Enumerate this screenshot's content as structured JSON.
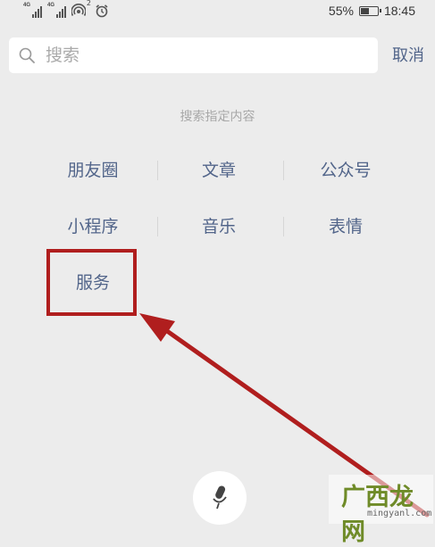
{
  "status_bar": {
    "signal_1_label": "4G",
    "signal_2_label": "4G",
    "hotspot_superscript": "2",
    "battery_percent": "55%",
    "battery_level": 0.55,
    "time": "18:45",
    "icons": [
      "signal-icon",
      "signal-icon",
      "hotspot-icon",
      "alarm-icon",
      "battery-icon"
    ]
  },
  "search": {
    "placeholder": "搜索",
    "cancel_label": "取消",
    "icon": "search-icon"
  },
  "hint": "搜索指定内容",
  "categories": [
    {
      "label": "朋友圈"
    },
    {
      "label": "文章"
    },
    {
      "label": "公众号"
    },
    {
      "label": "小程序"
    },
    {
      "label": "音乐"
    },
    {
      "label": "表情"
    },
    {
      "label": "服务"
    }
  ],
  "annotation": {
    "highlight_target": "服务",
    "color": "#b01e1e"
  },
  "voice": {
    "icon": "microphone-icon"
  },
  "watermark": {
    "logo_text": "广西龙网",
    "url": "mingyanl.com"
  },
  "colors": {
    "link": "#52658a",
    "background": "#ececec",
    "annotation": "#b01e1e",
    "hint": "#a8a8a8"
  }
}
